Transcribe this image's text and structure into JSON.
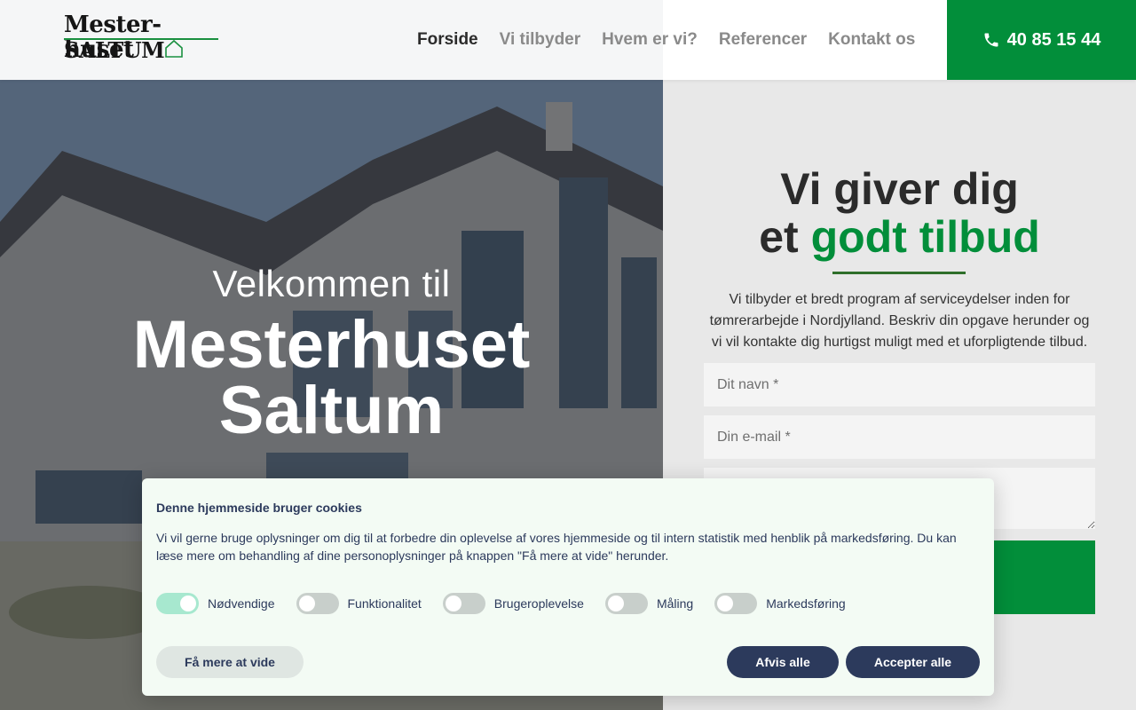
{
  "header": {
    "logo_line1": "Mester-huset",
    "logo_line2": "SALTUM",
    "nav": [
      {
        "label": "Forside",
        "active": true
      },
      {
        "label": "Vi tilbyder",
        "active": false
      },
      {
        "label": "Hvem er vi?",
        "active": false
      },
      {
        "label": "Referencer",
        "active": false
      },
      {
        "label": "Kontakt os",
        "active": false
      }
    ],
    "phone": "40 85 15 44",
    "phone_icon": "phone-icon"
  },
  "hero": {
    "subtitle": "Velkommen til",
    "title_line1": "Mesterhuset",
    "title_line2": "Saltum"
  },
  "form": {
    "heading_line1": "Vi giver dig",
    "heading_line2_plain": "et ",
    "heading_line2_green": "godt tilbud",
    "description": "Vi tilbyder et bredt program af serviceydelser inden for tømrerarbejde i Nordjylland. Beskriv din opgave herunder og vi vil kontakte dig hurtigst muligt med et uforpligtende tilbud.",
    "name_placeholder": "Dit navn *",
    "email_placeholder": "Din e-mail *"
  },
  "cookie": {
    "title": "Denne hjemmeside bruger cookies",
    "text": "Vi vil gerne bruge oplysninger om dig til at forbedre din oplevelse af vores hjemmeside og til intern statistik med henblik på markedsføring. Du kan læse mere om behandling af dine personoplysninger på knappen \"Få mere at vide\" herunder.",
    "toggles": [
      {
        "label": "Nødvendige",
        "on": true
      },
      {
        "label": "Funktionalitet",
        "on": false
      },
      {
        "label": "Brugeroplevelse",
        "on": false
      },
      {
        "label": "Måling",
        "on": false
      },
      {
        "label": "Markedsføring",
        "on": false
      }
    ],
    "more_label": "Få mere at vide",
    "reject_label": "Afvis alle",
    "accept_label": "Accepter alle"
  },
  "colors": {
    "brand_green": "#028e3a",
    "navy": "#2c3a5c"
  }
}
